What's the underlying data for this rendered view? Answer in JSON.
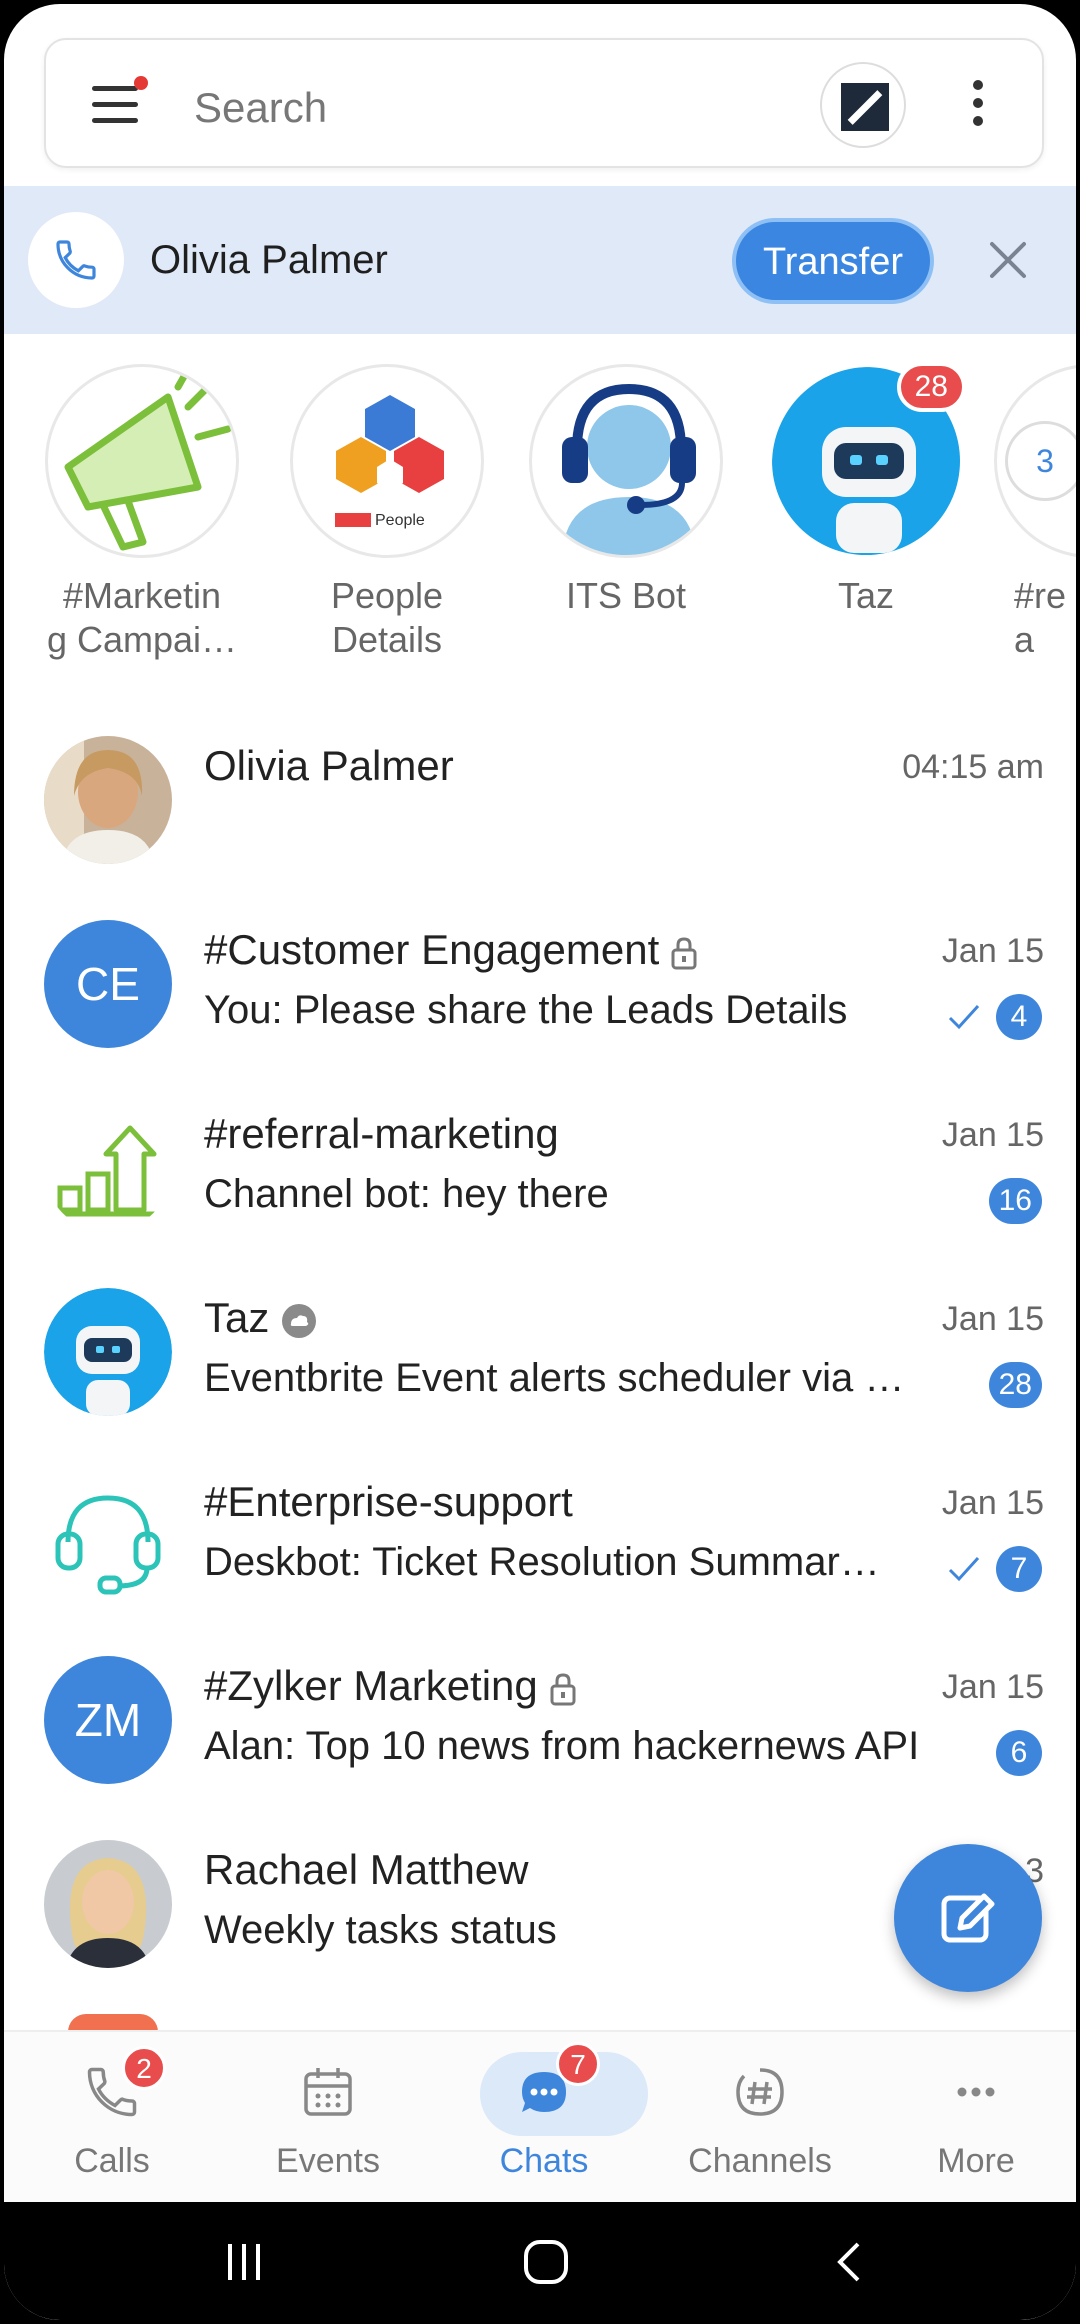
{
  "search": {
    "placeholder": "Search"
  },
  "call_banner": {
    "caller": "Olivia Palmer",
    "transfer_label": "Transfer"
  },
  "stories": [
    {
      "label": "#Marketin\ng Campai…"
    },
    {
      "label": "People\nDetails",
      "logo_text": "People"
    },
    {
      "label": "ITS Bot"
    },
    {
      "label": "Taz",
      "badge": "28"
    },
    {
      "label": "#re\na",
      "badge": "3"
    }
  ],
  "chats": [
    {
      "title": "Olivia Palmer",
      "time": "04:15 am",
      "subtitle": ""
    },
    {
      "title": "#Customer Engagement",
      "time": "Jan 15",
      "subtitle": "You: Please share the Leads Details",
      "count": "4",
      "initials": "CE"
    },
    {
      "title": "#referral-marketing",
      "time": "Jan 15",
      "subtitle": "Channel bot: hey there",
      "count": "16"
    },
    {
      "title": "Taz",
      "time": "Jan 15",
      "subtitle": "Eventbrite Event alerts scheduler via E…",
      "count": "28"
    },
    {
      "title": "#Enterprise-support",
      "time": "Jan 15",
      "subtitle": "Deskbot: Ticket Resolution Summar…",
      "count": "7"
    },
    {
      "title": "#Zylker Marketing",
      "time": "Jan 15",
      "subtitle": "Alan: Top 10 news from hackernews API",
      "count": "6",
      "initials": "ZM"
    },
    {
      "title": "Rachael Matthew",
      "time": "3",
      "subtitle": "Weekly tasks status"
    }
  ],
  "nav": [
    {
      "label": "Calls",
      "badge": "2"
    },
    {
      "label": "Events"
    },
    {
      "label": "Chats",
      "badge": "7"
    },
    {
      "label": "Channels"
    },
    {
      "label": "More"
    }
  ],
  "colors": {
    "accent": "#3e86dc",
    "badge": "#e84c4c",
    "banner": "#dfe9f7"
  }
}
